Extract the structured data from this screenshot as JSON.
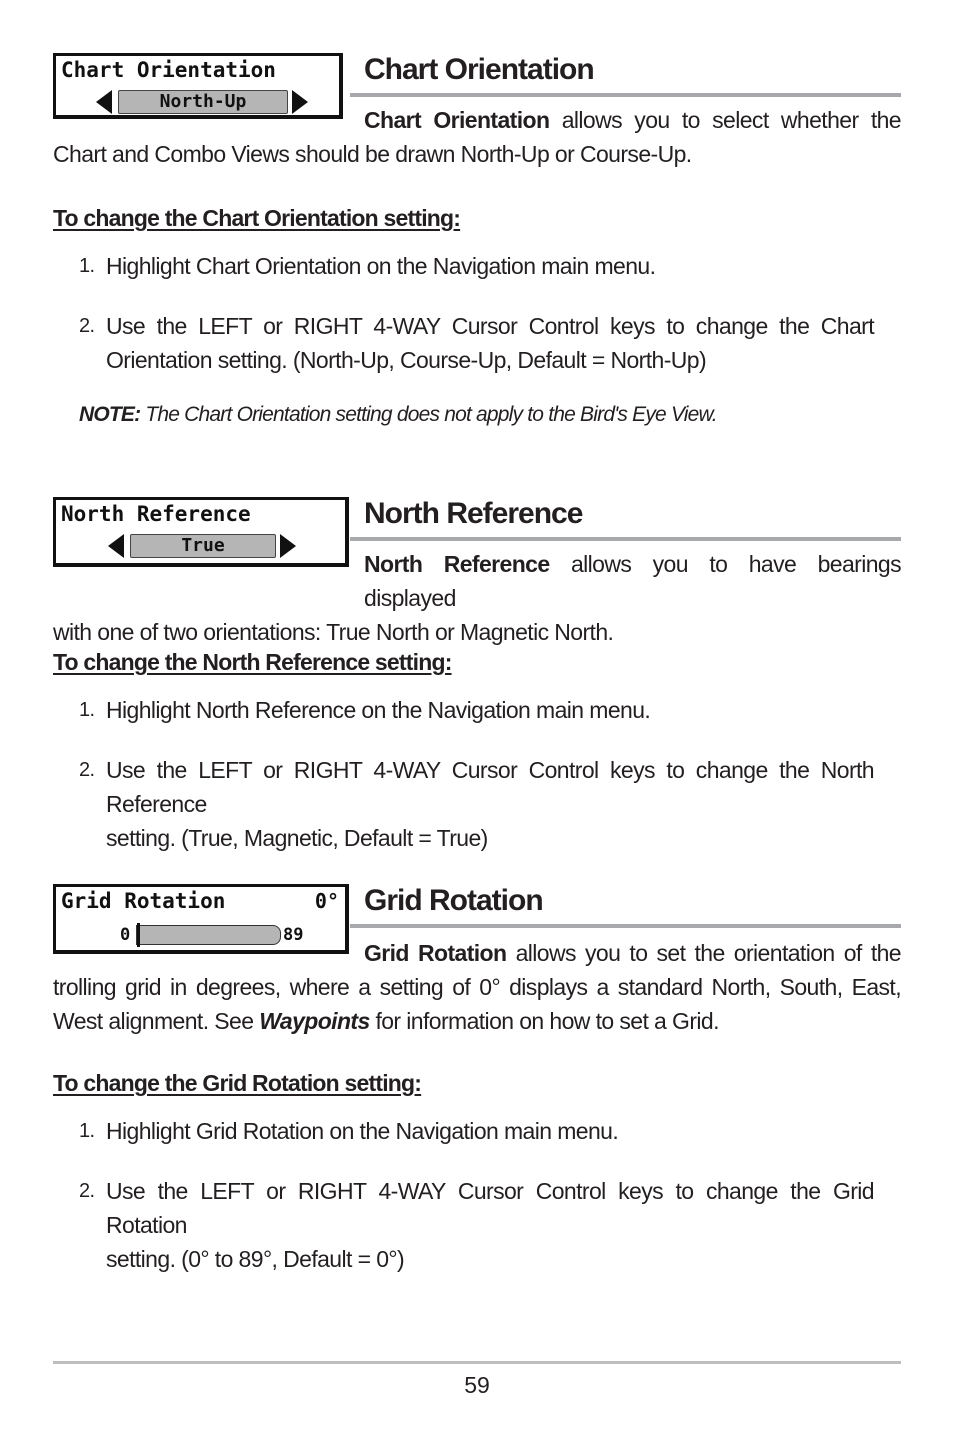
{
  "sections": [
    {
      "widget": {
        "title": "Chart Orientation",
        "value": "North-Up",
        "icons": [
          "arrow-left-icon",
          "arrow-right-icon"
        ]
      },
      "heading": "Chart Orientation",
      "intro": {
        "bold": "Chart Orientation",
        "line1_rest": " allows you to select whether the",
        "line2": "Chart and Combo Views should be drawn North-Up or Course-Up."
      },
      "subhead": "To change the Chart Orientation setting:",
      "steps": [
        {
          "num": "1.",
          "text": "Highlight Chart Orientation on the Navigation main menu."
        },
        {
          "num": "2.",
          "line1": "Use the LEFT or RIGHT 4-WAY Cursor Control keys to change the Chart",
          "line2": "Orientation setting. (North-Up, Course-Up, Default = North-Up)"
        }
      ],
      "note": {
        "label": "NOTE:",
        "text": " The Chart Orientation setting does not apply to the Bird's Eye View."
      }
    },
    {
      "widget": {
        "title": "North Reference",
        "value": "True",
        "icons": [
          "arrow-left-icon",
          "arrow-right-icon"
        ]
      },
      "heading": "North Reference",
      "intro": {
        "bold": "North Reference",
        "line1_rest": " allows you to have bearings displayed",
        "line2": "with one of two orientations: True North or Magnetic North."
      },
      "subhead": "To change the North Reference setting:",
      "steps": [
        {
          "num": "1.",
          "text": "Highlight North Reference on the Navigation main menu."
        },
        {
          "num": "2.",
          "line1": "Use the LEFT or RIGHT 4-WAY Cursor Control keys to change the North Reference",
          "line2": "setting. (True, Magnetic, Default = True)"
        }
      ]
    },
    {
      "widget": {
        "title": "Grid Rotation",
        "current_value": "0°",
        "slider_min": "0",
        "slider_max": "89",
        "slider_fraction": 0
      },
      "heading": "Grid Rotation",
      "intro": {
        "bold": "Grid Rotation",
        "line1_rest": " allows you to set the orientation of the",
        "line2": "trolling grid in degrees, where a setting of 0° displays a standard North, South, East,",
        "line3_pre": "West alignment. See ",
        "line3_link": "Waypoints",
        "line3_post": " for information on how to set a Grid."
      },
      "subhead": "To change the Grid Rotation setting:",
      "steps": [
        {
          "num": "1.",
          "text": "Highlight Grid Rotation on the Navigation main menu."
        },
        {
          "num": "2.",
          "line1": "Use the LEFT or RIGHT 4-WAY Cursor Control keys to change the Grid Rotation",
          "line2": "setting. (0° to 89°, Default = 0°)"
        }
      ]
    }
  ],
  "footer": {
    "page_number": "59"
  }
}
